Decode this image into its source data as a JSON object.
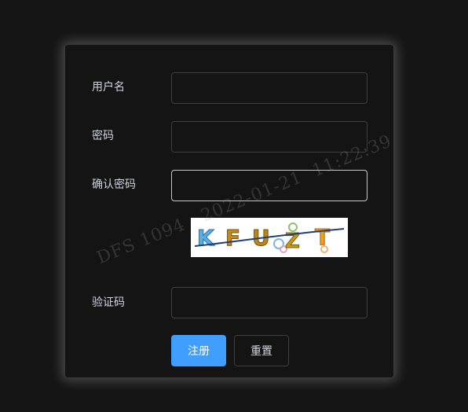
{
  "form": {
    "username_label": "用户名",
    "username_value": "",
    "password_label": "密码",
    "password_value": "",
    "confirm_label": "确认密码",
    "confirm_value": "",
    "captcha_label": "验证码",
    "captcha_value": "",
    "captcha_text": "KFUZT",
    "submit_label": "注册",
    "reset_label": "重置"
  },
  "watermark": {
    "text": "DFS 1094   2022-01-21  11:22:39"
  },
  "colors": {
    "primary": "#409eff",
    "background": "#151515",
    "card": "#141414"
  }
}
